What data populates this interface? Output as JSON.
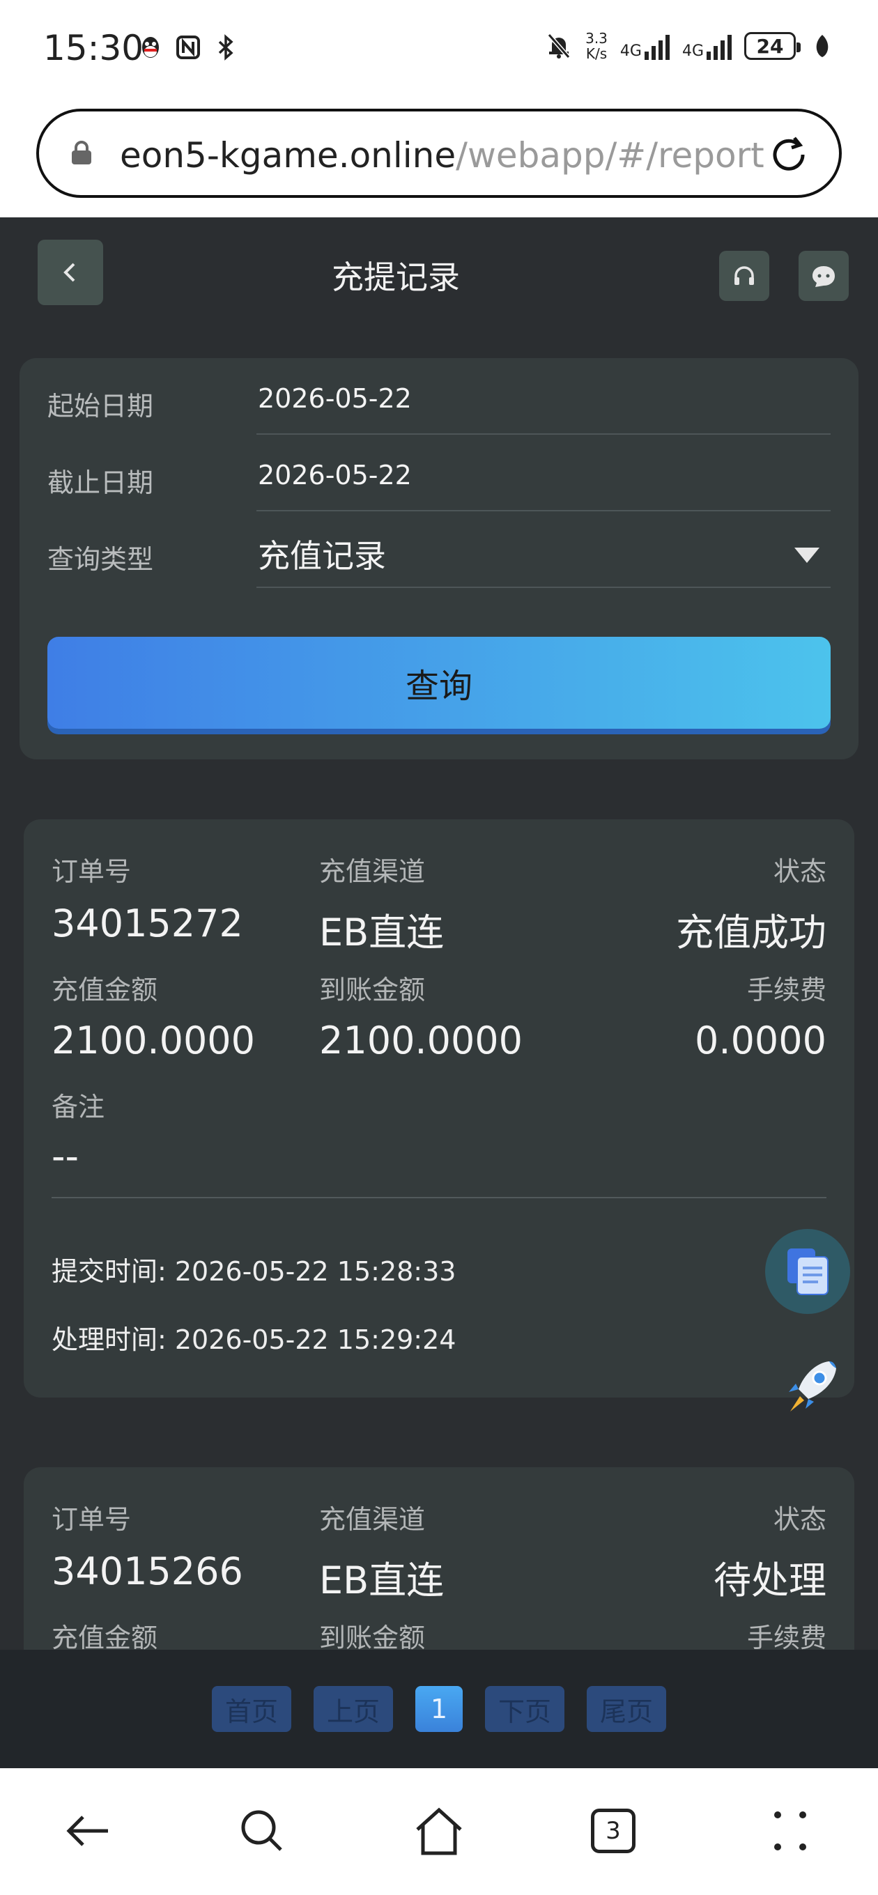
{
  "status_bar": {
    "time": "15:30",
    "speed_top": "3.3",
    "speed_bottom": "K/s",
    "net1": "4G",
    "net2": "4G",
    "battery": "24"
  },
  "browser": {
    "url_host": "eon5-kgame.online",
    "url_path": "/webapp/#/report",
    "tab_count": "3"
  },
  "header": {
    "title": "充提记录"
  },
  "query": {
    "start_label": "起始日期",
    "start_value": "2026-05-22",
    "end_label": "截止日期",
    "end_value": "2026-05-22",
    "type_label": "查询类型",
    "type_value": "充值记录",
    "submit_label": "查询"
  },
  "records": [
    {
      "order_label": "订单号",
      "order": "34015272",
      "channel_label": "充值渠道",
      "channel": "EB直连",
      "status_label": "状态",
      "status": "充值成功",
      "amount_label": "充值金额",
      "amount": "2100.0000",
      "received_label": "到账金额",
      "received": "2100.0000",
      "fee_label": "手续费",
      "fee": "0.0000",
      "note_label": "备注",
      "note": "--",
      "submit_time": "提交时间: 2026-05-22 15:28:33",
      "process_time": "处理时间: 2026-05-22 15:29:24"
    },
    {
      "order_label": "订单号",
      "order": "34015266",
      "channel_label": "充值渠道",
      "channel": "EB直连",
      "status_label": "状态",
      "status": "待处理",
      "amount_label": "充值金额",
      "received_label": "到账金额",
      "fee_label": "手续费"
    }
  ],
  "pager": {
    "first": "首页",
    "prev": "上页",
    "current": "1",
    "next": "下页",
    "last": "尾页"
  },
  "colors": {
    "background": "#2b2e31",
    "card": "#343b3c",
    "accent_start": "#3f7ee6",
    "accent_end": "#4cc3ec"
  }
}
